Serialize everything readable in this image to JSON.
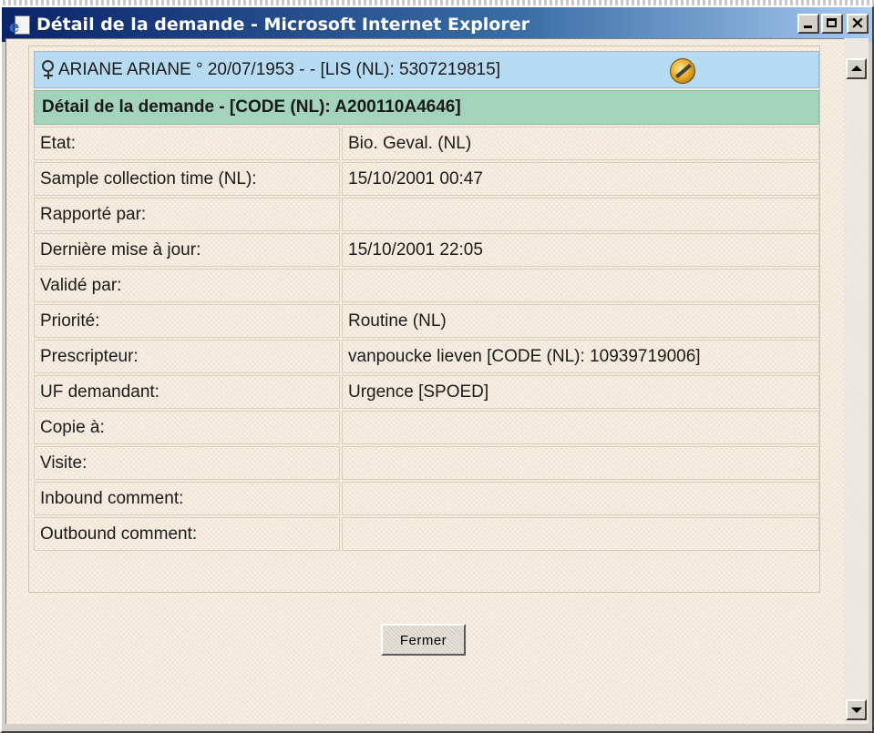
{
  "window": {
    "title": "Détail de la demande - Microsoft Internet Explorer"
  },
  "patient": {
    "info": "ARIANE ARIANE  ° 20/07/1953 - - [LIS (NL): 5307219815]"
  },
  "detail": {
    "header": "Détail de la demande - [CODE (NL): A200110A4646]",
    "rows": [
      {
        "label": "Etat:",
        "value": "Bio. Geval. (NL)"
      },
      {
        "label": "Sample collection time (NL):",
        "value": "15/10/2001 00:47"
      },
      {
        "label": "Rapporté par:",
        "value": ""
      },
      {
        "label": "Dernière mise à jour:",
        "value": "15/10/2001 22:05"
      },
      {
        "label": "Validé par:",
        "value": ""
      },
      {
        "label": "Priorité:",
        "value": "Routine (NL)"
      },
      {
        "label": "Prescripteur:",
        "value": "vanpoucke lieven [CODE (NL): 10939719006]"
      },
      {
        "label": "UF demandant:",
        "value": "Urgence [SPOED]"
      },
      {
        "label": "Copie à:",
        "value": ""
      },
      {
        "label": "Visite:",
        "value": ""
      },
      {
        "label": "Inbound comment:",
        "value": ""
      },
      {
        "label": "Outbound comment:",
        "value": ""
      }
    ]
  },
  "buttons": {
    "close_label": "Fermer"
  }
}
